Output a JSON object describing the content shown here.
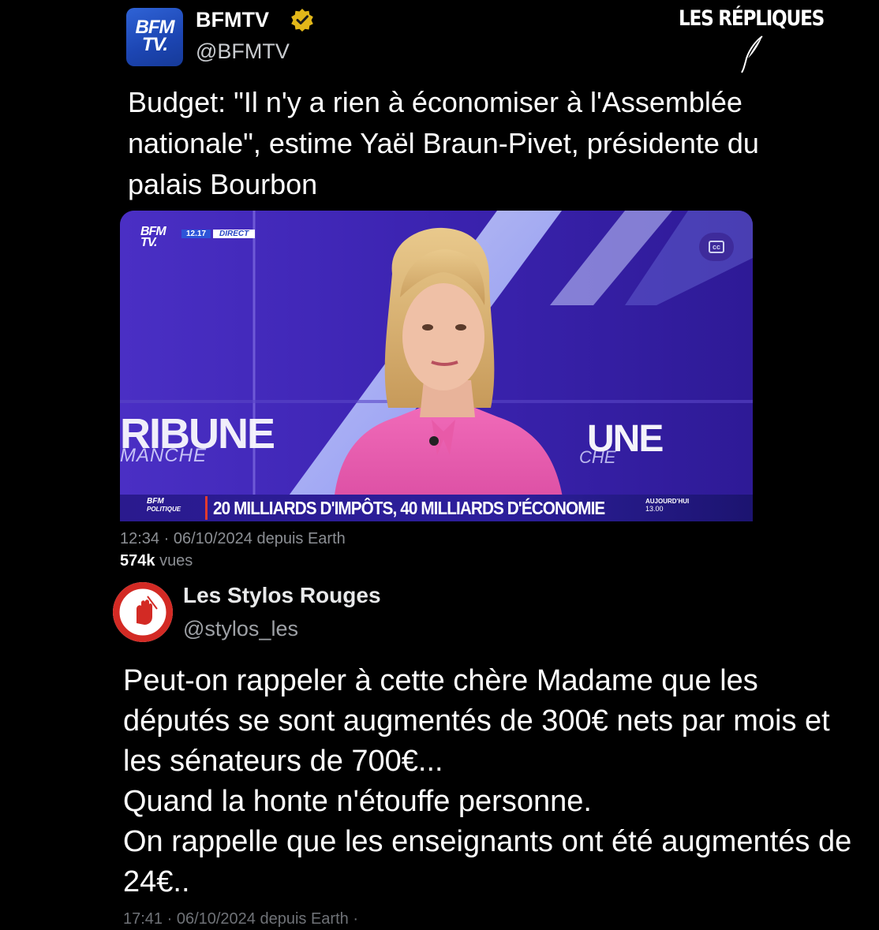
{
  "tweet1": {
    "avatar_line1": "BFM",
    "avatar_line2": "TV.",
    "name": "BFMTV",
    "handle": "@BFMTV",
    "text": "Budget: \"Il n'y a rien à économiser à l'Assemblée nationale\", estime Yaël Braun-Pivet, présidente du palais Bourbon",
    "meta": "12:34 · 06/10/2024 depuis Earth",
    "views_count": "574k",
    "views_label": "vues"
  },
  "watermark": {
    "text": "LES RÉPLIQUES"
  },
  "video": {
    "logo_line1": "BFM",
    "logo_line2": "TV.",
    "time": "12.17",
    "live_label": "DIRECT",
    "cc_label": "cc",
    "backdrop_left": "RIBUNE",
    "backdrop_left_sub": "MANCHE",
    "backdrop_right": "UNE",
    "backdrop_right_sub": "CHE",
    "ticker_brand_line1": "BFM",
    "ticker_brand_line2": "POLITIQUE",
    "ticker_headline": "20 MILLIARDS D'IMPÔTS, 40 MILLIARDS D'ÉCONOMIE",
    "ticker_today": "AUJOURD'HUI",
    "ticker_today_time": "13.00"
  },
  "tweet2": {
    "name": "Les Stylos Rouges",
    "handle": "@stylos_les",
    "text": "Peut-on rappeler à cette chère Madame que les députés se sont augmentés de 300€ nets par mois et les sénateurs de 700€...\nQuand la honte n'étouffe personne.\nOn rappelle que les enseignants ont été augmentés de 24€..",
    "meta": "17:41 · 06/10/2024 depuis Earth ·"
  },
  "colors": {
    "background": "#000000",
    "bfm_blue": "#1c45b2",
    "verified_gold": "#e2b719",
    "video_purple": "#3a22a8",
    "ticker_red": "#e23a2e"
  }
}
